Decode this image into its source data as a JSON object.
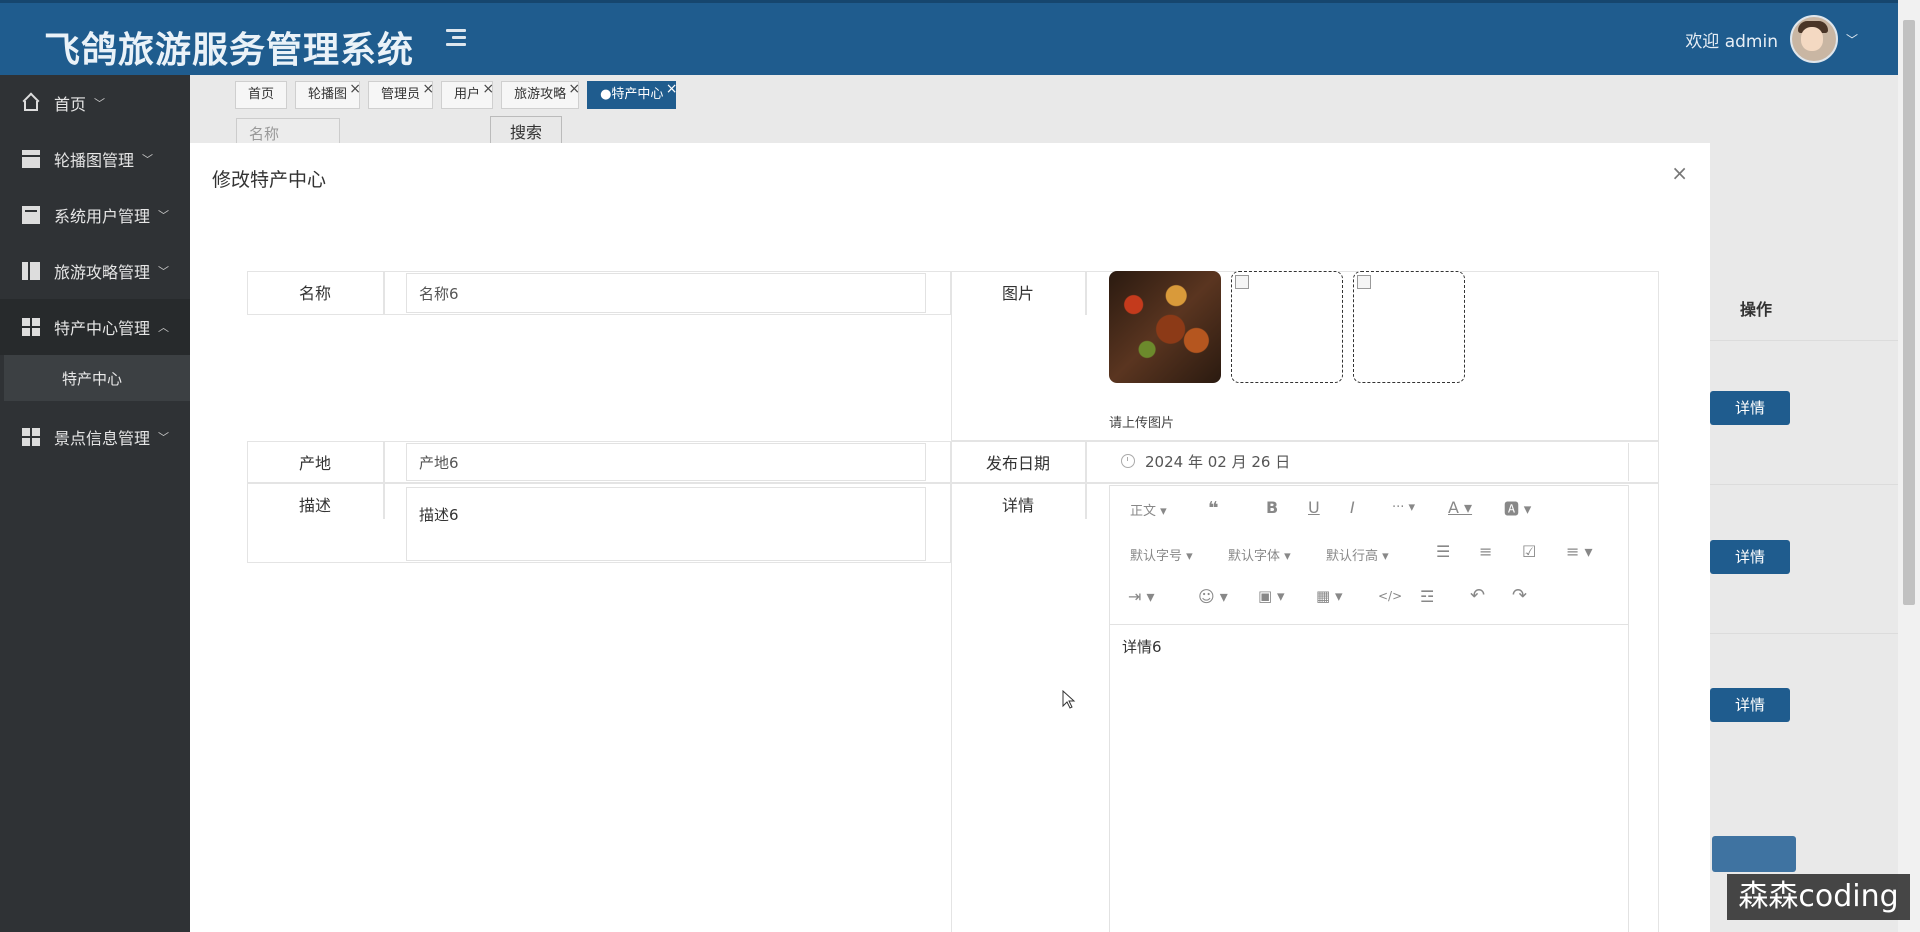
{
  "header": {
    "title": "飞鸽旅游服务管理系统",
    "welcome": "欢迎 admin",
    "colors": {
      "primary": "#1f5c8e",
      "sidebar": "#2f3235"
    }
  },
  "sidebar": {
    "items": [
      {
        "label": "首页",
        "icon": "home-icon"
      },
      {
        "label": "轮播图管理",
        "icon": "archive-icon"
      },
      {
        "label": "系统用户管理",
        "icon": "card-icon"
      },
      {
        "label": "旅游攻略管理",
        "icon": "book-icon"
      },
      {
        "label": "特产中心管理",
        "icon": "grid-icon"
      },
      {
        "label": "景点信息管理",
        "icon": "grid-icon"
      }
    ],
    "sub_item": "特产中心"
  },
  "tabs": [
    "首页",
    "轮播图",
    "管理员",
    "用户",
    "旅游攻略",
    "●特产中心"
  ],
  "background": {
    "search_placeholder": "名称",
    "search_button": "搜索",
    "column_op": "操作",
    "detail_button": "详情"
  },
  "modal": {
    "title": "修改特产中心",
    "close": "×",
    "fields": {
      "name_label": "名称",
      "name_value": "名称6",
      "image_label": "图片",
      "upload_hint": "请上传图片",
      "origin_label": "产地",
      "origin_value": "产地6",
      "date_label": "发布日期",
      "date_value": "2024 年 02 月 26 日",
      "desc_label": "描述",
      "desc_value": "描述6",
      "detail_label": "详情",
      "detail_value": "详情6"
    },
    "editor_toolbar": {
      "paragraph": "正文",
      "font_size": "默认字号",
      "font_family": "默认字体",
      "line_height": "默认行高"
    }
  },
  "watermark": "森森coding"
}
